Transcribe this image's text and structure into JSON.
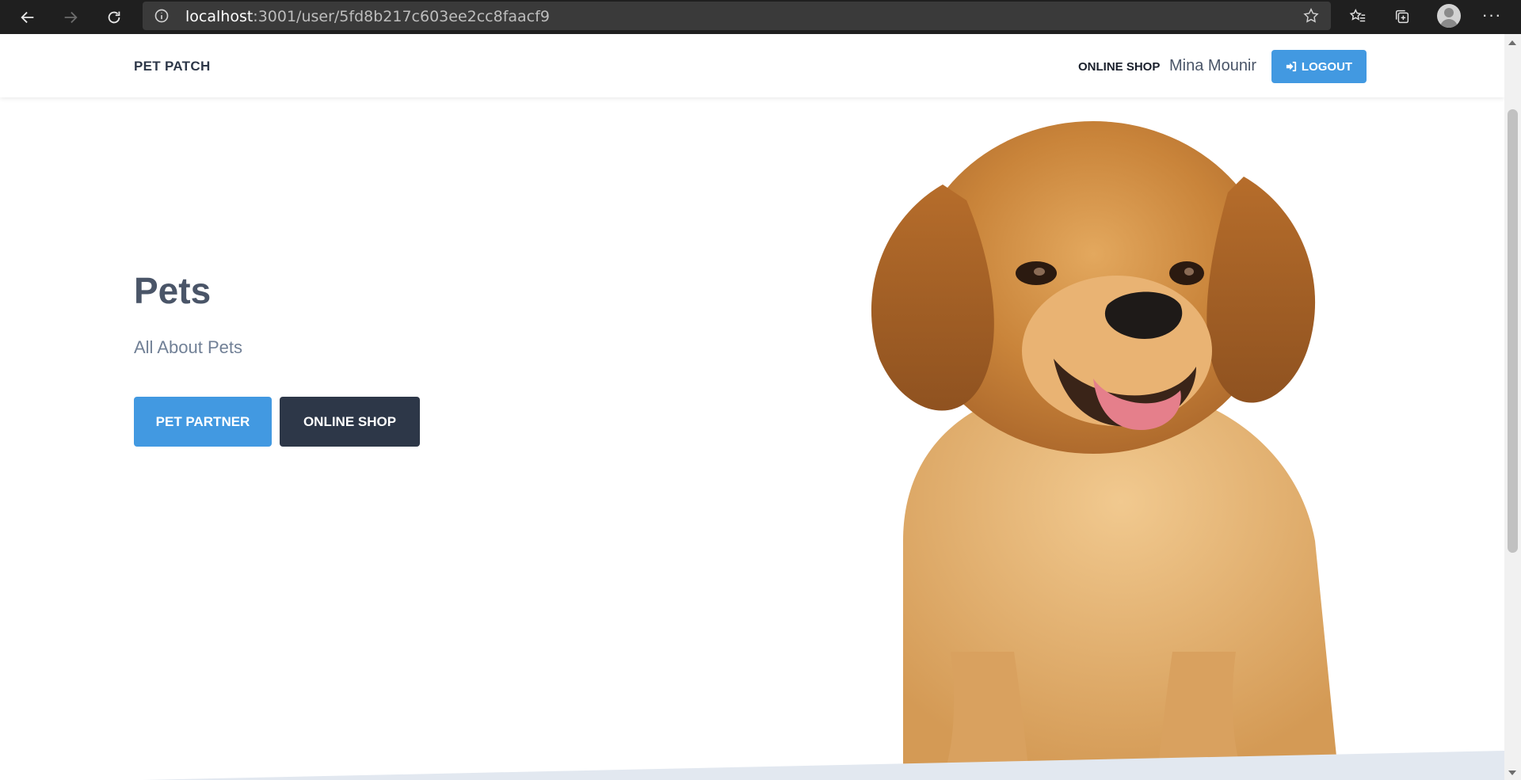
{
  "browser": {
    "url_host": "localhost",
    "url_rest": ":3001/user/5fd8b217c603ee2cc8faacf9",
    "icons": [
      "back-icon",
      "forward-icon",
      "refresh-icon",
      "info-icon",
      "star-icon",
      "favorites-icon",
      "collections-icon",
      "profile-icon",
      "more-icon"
    ]
  },
  "header": {
    "brand": "PET PATCH",
    "nav_link": "ONLINE SHOP",
    "user_name": "Mina Mounir",
    "logout_label": "LOGOUT"
  },
  "hero": {
    "title": "Pets",
    "subtitle": "All About Pets",
    "btn_partner": "PET PARTNER",
    "btn_shop": "ONLINE SHOP"
  },
  "colors": {
    "primary": "#4299e1",
    "dark": "#2d3748",
    "text_gray": "#4a5568",
    "wave": "#e2e8f0"
  }
}
